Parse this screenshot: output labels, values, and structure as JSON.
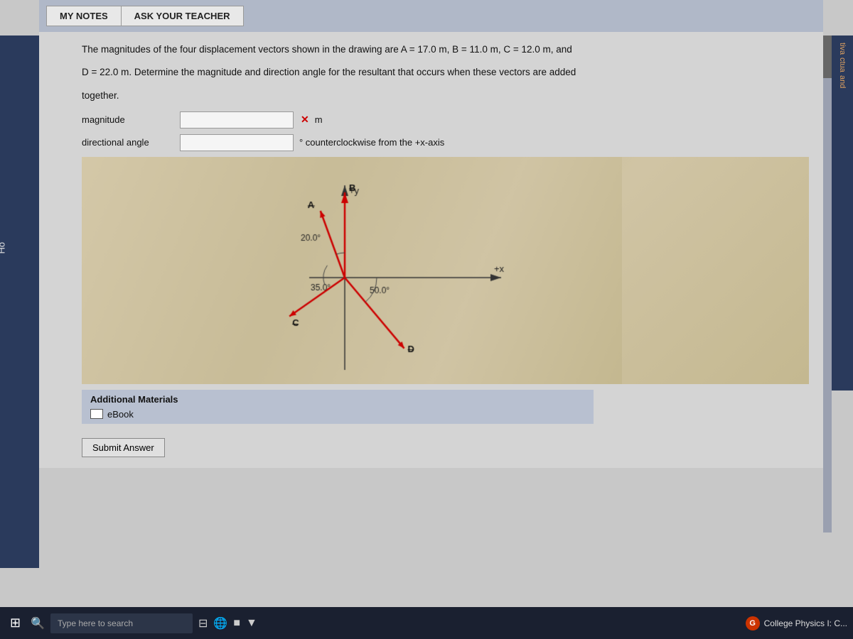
{
  "header": {
    "my_notes_label": "MY NOTES",
    "ask_teacher_label": "ASK YOUR TEACHER"
  },
  "problem": {
    "text_line1": "The magnitudes of the four displacement vectors shown in the drawing are A = 17.0 m, B = 11.0 m, C = 12.0 m, and",
    "text_line2": "D = 22.0 m. Determine the magnitude and direction angle for the resultant that occurs when these vectors are added",
    "text_line3": "together.",
    "magnitude_label": "magnitude",
    "magnitude_placeholder": "",
    "magnitude_unit": "m",
    "magnitude_x_mark": "✕",
    "direction_label": "directional angle",
    "direction_placeholder": "",
    "direction_suffix": "° counterclockwise from the +x-axis"
  },
  "diagram": {
    "plus_y_label": "+y",
    "plus_x_label": "+x",
    "angle_a": "20.0°",
    "angle_b": "35.0°",
    "angle_c": "50.0°",
    "vector_a_label": "A",
    "vector_b_label": "B",
    "vector_c_label": "C",
    "vector_d_label": "D"
  },
  "additional_materials": {
    "title": "Additional Materials",
    "ebook_label": "eBook"
  },
  "submit": {
    "label": "Submit Answer"
  },
  "taskbar": {
    "search_placeholder": "Type here to search",
    "app_label": "College Physics I: C..."
  },
  "sidebar_right": {
    "line1": "tiva",
    "line2": "ctua",
    "line3": "and"
  }
}
